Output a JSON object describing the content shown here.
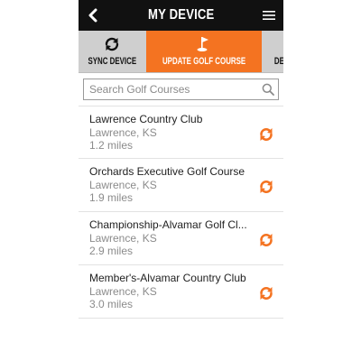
{
  "header": {
    "title": "MY DEVICE",
    "back_icon": "chevron-left-icon",
    "menu_icon": "hamburger-menu-icon"
  },
  "tabs": [
    {
      "label": "SYNC DEVICE",
      "icon": "sync-icon",
      "active": false
    },
    {
      "label": "UPDATE GOLF COURSE",
      "icon": "golf-flag-icon",
      "active": true
    },
    {
      "label": "DEVICE SETTINGS",
      "icon": "gear-icon",
      "active": false
    }
  ],
  "search": {
    "placeholder": "Search Golf Courses",
    "value": ""
  },
  "courses": [
    {
      "name": "Lawrence Country Club",
      "location": "Lawrence, KS",
      "distance": "1.2 miles"
    },
    {
      "name": "Orchards Executive Golf Course",
      "location": "Lawrence, KS",
      "distance": "1.9 miles"
    },
    {
      "name": "Championship-Alvamar Golf Cl...",
      "location": "Lawrence, KS",
      "distance": "2.9 miles"
    },
    {
      "name": "Member's-Alvamar Country Club",
      "location": "Lawrence, KS",
      "distance": "3.0 miles"
    }
  ],
  "colors": {
    "accent": "#f47321",
    "header_bg": "#111111",
    "tab_bg": "#cfcfcf"
  }
}
